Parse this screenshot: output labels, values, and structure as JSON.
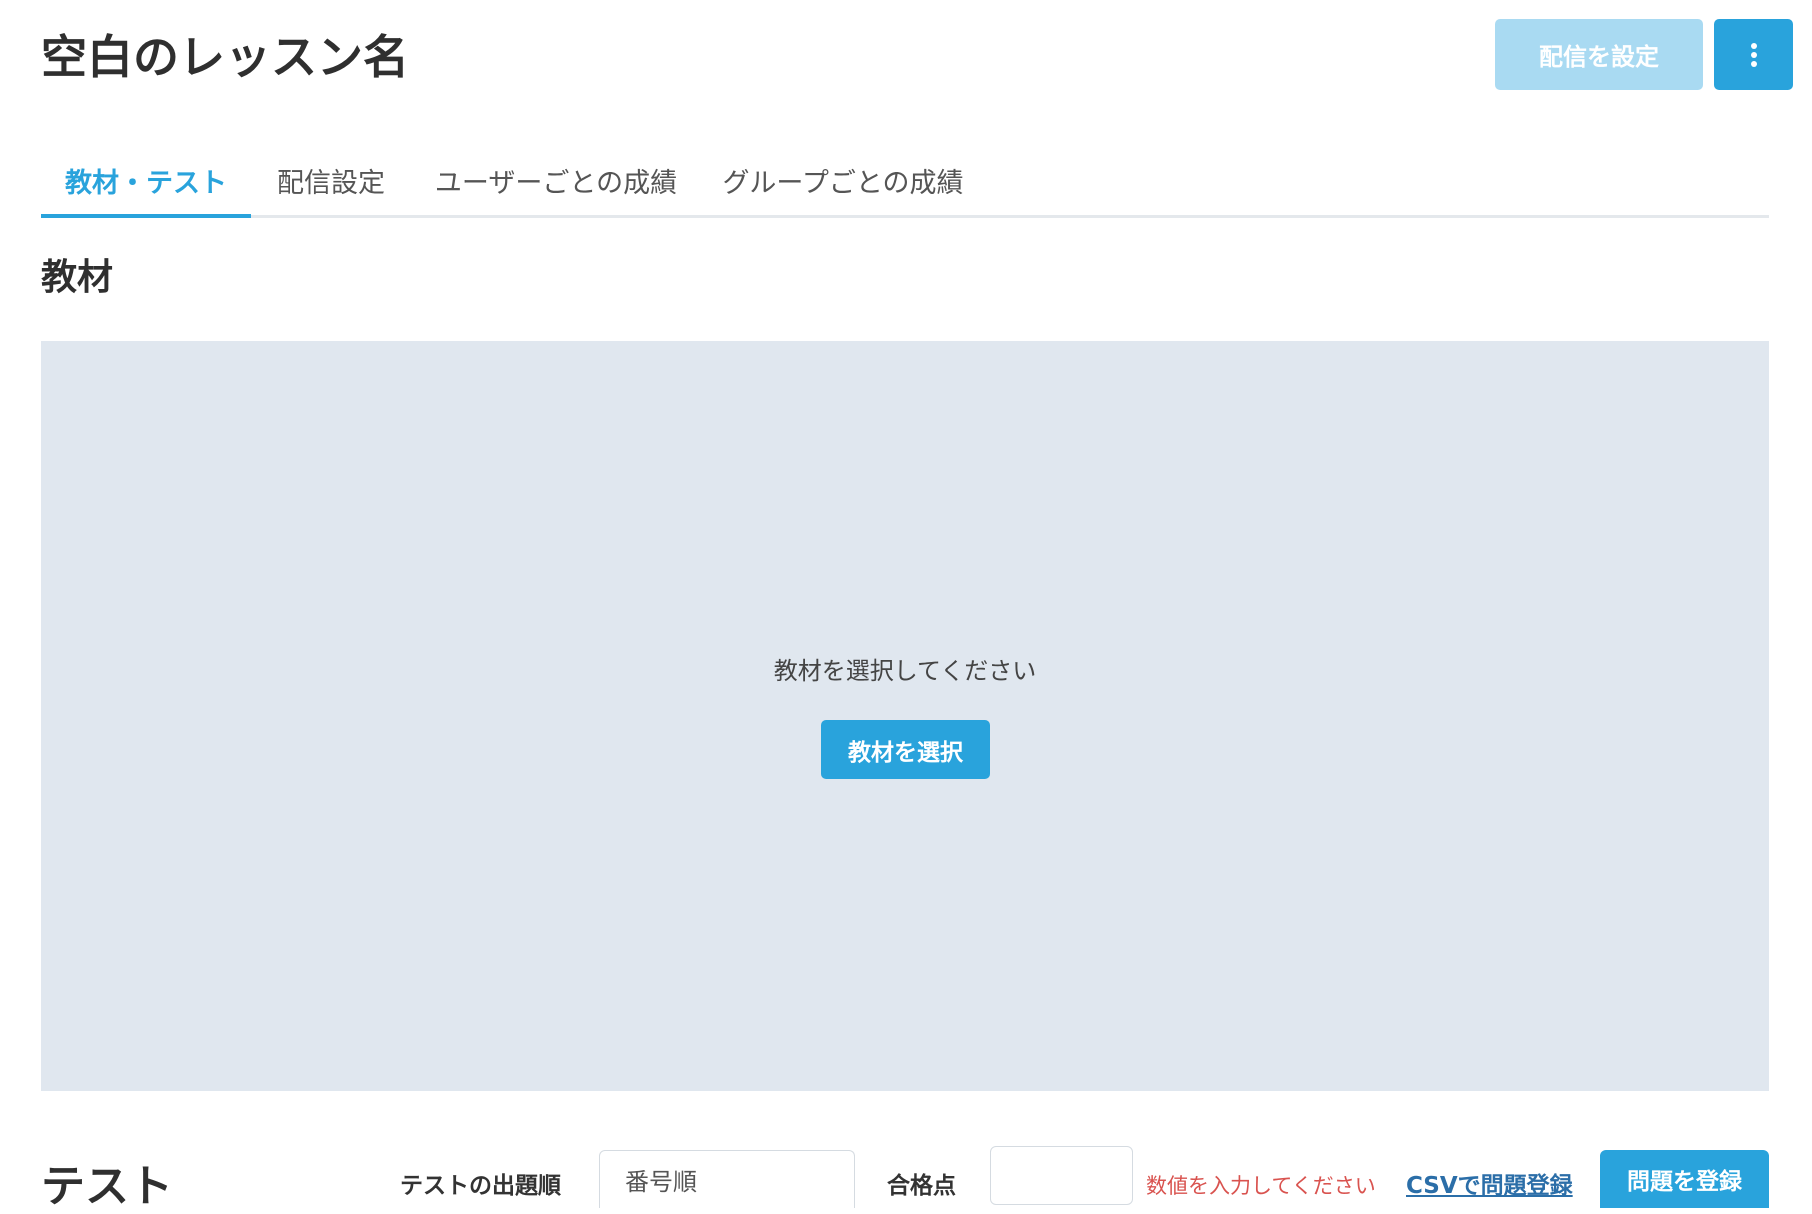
{
  "header": {
    "title": "空白のレッスン名",
    "distribute_button_label": "配信を設定",
    "more_icon": "vertical-ellipsis-icon"
  },
  "tabs": [
    {
      "label": "教材・テスト",
      "active": true
    },
    {
      "label": "配信設定",
      "active": false
    },
    {
      "label": "ユーザーごとの成績",
      "active": false
    },
    {
      "label": "グループごとの成績",
      "active": false
    }
  ],
  "materials": {
    "title": "教材",
    "empty_message": "教材を選択してください",
    "select_button_label": "教材を選択"
  },
  "test": {
    "title": "テスト",
    "order_label": "テストの出題順",
    "order_value": "番号順",
    "pass_label": "合格点",
    "pass_value": "",
    "pass_error": "数値を入力してください",
    "csv_link_label": "CSVで問題登録",
    "register_button_label": "問題を登録"
  },
  "colors": {
    "accent": "#29a3dc",
    "accent_disabled": "#a9daf2",
    "materials_background": "#e0e7ef",
    "error": "#d9534f",
    "link": "#2b6ea8"
  }
}
